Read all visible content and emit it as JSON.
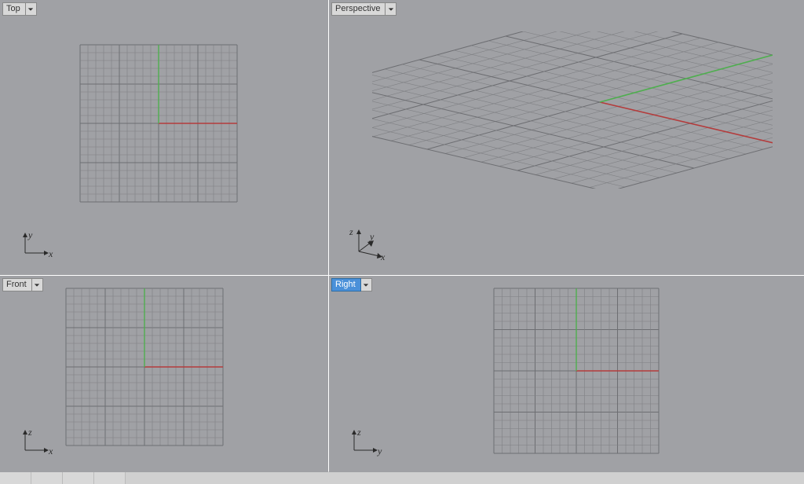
{
  "viewports": {
    "top": {
      "label": "Top",
      "active": false,
      "axis1": "y",
      "axis2": "x"
    },
    "perspective": {
      "label": "Perspective",
      "active": false,
      "axis1": "z",
      "axis2": "y",
      "axis3": "x"
    },
    "front": {
      "label": "Front",
      "active": false,
      "axis1": "z",
      "axis2": "x"
    },
    "right": {
      "label": "Right",
      "active": true,
      "axis1": "z",
      "axis2": "y"
    }
  },
  "grid": {
    "extent": 10,
    "major_every": 5,
    "axis_colors": {
      "x": "#b43c3c",
      "y": "#4fae4f",
      "z": "#3c6ab4"
    },
    "line_color": "#7f8084",
    "major_line_color": "#6d6e72"
  }
}
